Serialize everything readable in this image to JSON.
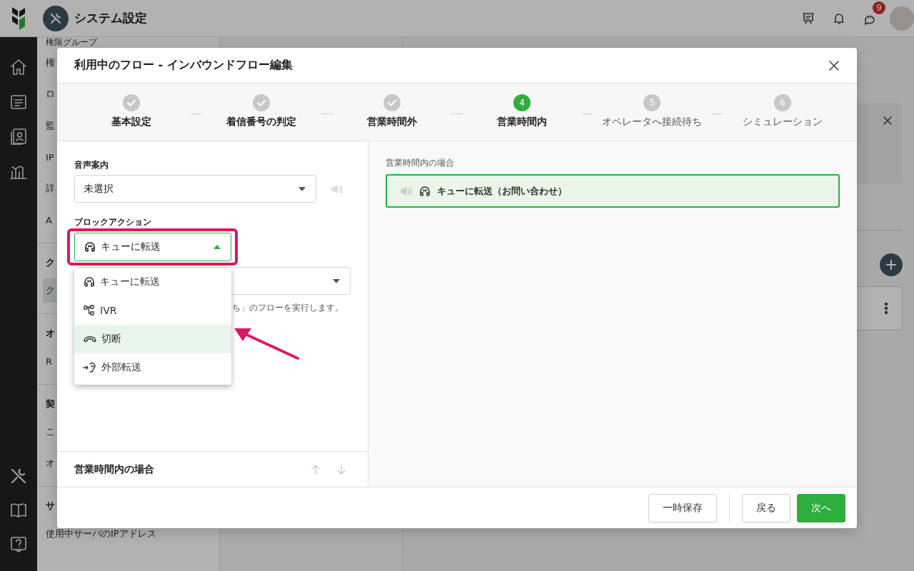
{
  "header": {
    "title": "システム設定",
    "notification_count": "9"
  },
  "settings_menu": {
    "sections": [
      {
        "items": [
          {
            "label": "権限グループ",
            "selected": false
          },
          {
            "label": "権",
            "selected": false
          },
          {
            "label": "ロ",
            "selected": false
          },
          {
            "label": "監",
            "selected": false
          },
          {
            "label": "IP",
            "selected": false
          },
          {
            "label": "詳",
            "selected": false
          },
          {
            "label": "A",
            "selected": false
          }
        ]
      },
      {
        "heading": "ク",
        "items": [
          {
            "label": "ク",
            "selected": true
          }
        ]
      },
      {
        "heading": "オ",
        "items": [
          {
            "label": "R",
            "selected": false
          }
        ]
      },
      {
        "heading": "契",
        "items": [
          {
            "label": "こ",
            "selected": false
          },
          {
            "label": "オ",
            "selected": false
          }
        ]
      },
      {
        "heading": "サ",
        "items": [
          {
            "label": "使用中サーバのIPアドレス",
            "selected": false
          }
        ]
      }
    ]
  },
  "modal": {
    "title": "利用中のフロー - インバウンドフロー編集",
    "steps": [
      {
        "label": "基本設定",
        "completed": true,
        "selected": false
      },
      {
        "label": "着信番号の判定",
        "completed": true,
        "selected": false
      },
      {
        "label": "営業時間外",
        "completed": true,
        "selected": false
      },
      {
        "label": "営業時間内",
        "completed": false,
        "selected": true,
        "number": "4"
      },
      {
        "label": "オペレータへ接続待ち",
        "completed": false,
        "selected": false,
        "number": "5"
      },
      {
        "label": "シミュレーション",
        "completed": false,
        "selected": false,
        "number": "6"
      }
    ],
    "voice_guide": {
      "label": "音声案内",
      "value": "未選択"
    },
    "block_action": {
      "label": "ブロックアクション",
      "value": "キューに転送",
      "kind": "queue",
      "expanded": true,
      "options": [
        {
          "label": "キューに転送",
          "kind": "queue",
          "highlighted": false
        },
        {
          "label": "IVR",
          "kind": "ivr",
          "highlighted": false
        },
        {
          "label": "切断",
          "kind": "hangup",
          "highlighted": true
        },
        {
          "label": "外部転送",
          "kind": "external",
          "highlighted": false
        }
      ]
    },
    "next_field": {
      "helper": "ち」のフローを実行します。"
    },
    "section": {
      "title": "営業時間内の場合"
    },
    "preview": {
      "label": "営業時間内の場合",
      "block": "キューに転送（お問い合わせ）",
      "kind": "queue"
    },
    "buttons": [
      {
        "label": "一時保存",
        "kind": "secondary"
      },
      {
        "label": "戻る",
        "kind": "secondary"
      },
      {
        "label": "次へ",
        "kind": "primary"
      }
    ]
  },
  "annotation": {
    "highlight_frame": true,
    "arrow": true
  }
}
